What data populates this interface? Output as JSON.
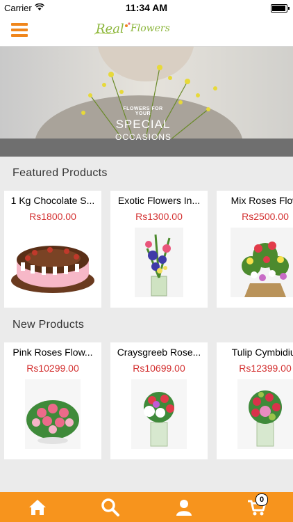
{
  "status_bar": {
    "carrier": "Carrier",
    "time": "11:34 AM"
  },
  "header": {
    "logo_text": "Real Flowers",
    "menu_icon": "hamburger-icon"
  },
  "banner": {
    "line1": "FLOWERS FOR YOUR",
    "line2": "SPECIAL",
    "line3": "OCCASIONS"
  },
  "featured": {
    "title": "Featured Products",
    "items": [
      {
        "name": "1 Kg Chocolate S...",
        "price": "Rs1800.00"
      },
      {
        "name": "Exotic Flowers In...",
        "price": "Rs1300.00"
      },
      {
        "name": "Mix Roses Flow",
        "price": "Rs2500.00"
      }
    ]
  },
  "new_products": {
    "title": "New Products",
    "items": [
      {
        "name": "Pink Roses Flow...",
        "price": "Rs10299.00"
      },
      {
        "name": "Craysgreeb Rose...",
        "price": "Rs10699.00"
      },
      {
        "name": "Tulip Cymbidiur",
        "price": "Rs12399.00"
      }
    ]
  },
  "tabbar": {
    "items": [
      "home-icon",
      "search-icon",
      "user-icon",
      "cart-icon"
    ],
    "cart_count": "0",
    "color": "#f7941d"
  },
  "colors": {
    "accent": "#f0861c",
    "price": "#d32f2f"
  }
}
